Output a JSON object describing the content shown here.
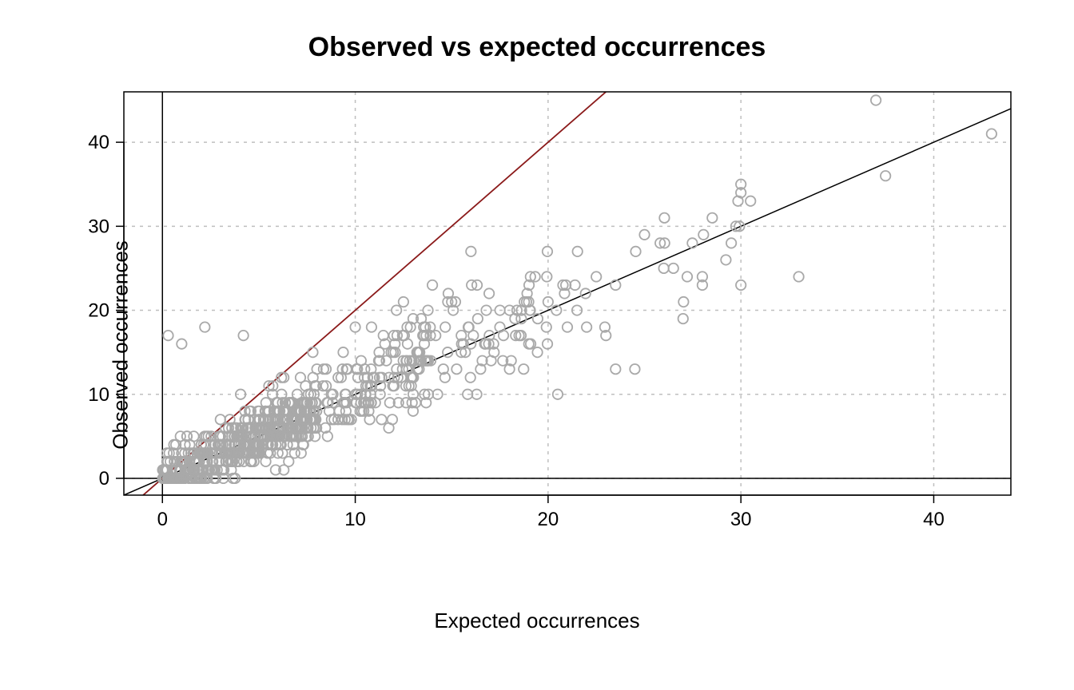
{
  "chart_data": {
    "type": "scatter",
    "title": "Observed vs expected occurrences",
    "xlabel": "Expected occurrences",
    "ylabel": "Observed occurrences",
    "xlim": [
      -2,
      44
    ],
    "ylim": [
      -2,
      46
    ],
    "x_ticks": [
      0,
      10,
      20,
      30,
      40
    ],
    "y_ticks": [
      0,
      10,
      20,
      30,
      40
    ],
    "grid": true,
    "lines": [
      {
        "name": "identity",
        "slope": 1.0,
        "intercept": 0,
        "color": "#000000"
      },
      {
        "name": "steep",
        "slope": 2.0,
        "intercept": 0,
        "color": "#8b1a1a"
      }
    ],
    "n_points_approx": 900,
    "cloud": {
      "description": "Dense cloud of open grey circles near origin, thinning toward upper-right",
      "seed": 42,
      "clusters": [
        {
          "n": 520,
          "x_range": [
            0,
            8
          ],
          "y_spread": 1.6,
          "y_bias": 0.0
        },
        {
          "n": 210,
          "x_range": [
            4,
            14
          ],
          "y_spread": 2.4,
          "y_bias": 0.5
        },
        {
          "n": 90,
          "x_range": [
            10,
            20
          ],
          "y_spread": 3.2,
          "y_bias": 0.5
        },
        {
          "n": 30,
          "x_range": [
            18,
            30
          ],
          "y_spread": 3.5,
          "y_bias": 0.0
        }
      ]
    },
    "labeled_points": [
      {
        "x": 0.3,
        "y": 17
      },
      {
        "x": 2.2,
        "y": 18
      },
      {
        "x": 1.0,
        "y": 16
      },
      {
        "x": 4.2,
        "y": 17
      },
      {
        "x": 7.8,
        "y": 15
      },
      {
        "x": 10.0,
        "y": 18
      },
      {
        "x": 12.0,
        "y": 17
      },
      {
        "x": 12.5,
        "y": 21
      },
      {
        "x": 13.0,
        "y": 19
      },
      {
        "x": 13.0,
        "y": 8
      },
      {
        "x": 14.0,
        "y": 23
      },
      {
        "x": 14.8,
        "y": 21
      },
      {
        "x": 15.0,
        "y": 21
      },
      {
        "x": 15.5,
        "y": 17
      },
      {
        "x": 16.0,
        "y": 27
      },
      {
        "x": 16.3,
        "y": 10
      },
      {
        "x": 16.5,
        "y": 13
      },
      {
        "x": 17.2,
        "y": 15
      },
      {
        "x": 18.0,
        "y": 20
      },
      {
        "x": 18.0,
        "y": 13
      },
      {
        "x": 19.0,
        "y": 16
      },
      {
        "x": 20.0,
        "y": 21
      },
      {
        "x": 20.5,
        "y": 10
      },
      {
        "x": 21.0,
        "y": 18
      },
      {
        "x": 21.5,
        "y": 20
      },
      {
        "x": 22.0,
        "y": 18
      },
      {
        "x": 22.5,
        "y": 24
      },
      {
        "x": 23.0,
        "y": 17
      },
      {
        "x": 23.5,
        "y": 23
      },
      {
        "x": 23.5,
        "y": 13
      },
      {
        "x": 24.5,
        "y": 13
      },
      {
        "x": 25.0,
        "y": 29
      },
      {
        "x": 26.0,
        "y": 25
      },
      {
        "x": 26.5,
        "y": 25
      },
      {
        "x": 27.0,
        "y": 19
      },
      {
        "x": 28.0,
        "y": 24
      },
      {
        "x": 28.0,
        "y": 23
      },
      {
        "x": 29.5,
        "y": 28
      },
      {
        "x": 30.0,
        "y": 35
      },
      {
        "x": 30.0,
        "y": 34
      },
      {
        "x": 30.0,
        "y": 23
      },
      {
        "x": 30.5,
        "y": 33
      },
      {
        "x": 33.0,
        "y": 24
      },
      {
        "x": 37.0,
        "y": 45
      },
      {
        "x": 37.5,
        "y": 36
      },
      {
        "x": 43.0,
        "y": 41
      }
    ]
  }
}
